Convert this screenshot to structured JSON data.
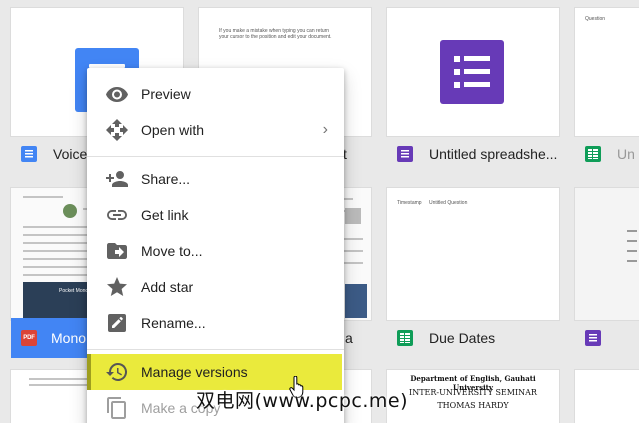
{
  "files": {
    "voice": {
      "name": "Voice",
      "type": "doc"
    },
    "quiz_doc": {
      "name": "t",
      "preview_text": "If you make a mistake when typing you can return your cursor to the position and edit your document."
    },
    "untitled_spreadsheet": {
      "name": "Untitled spreadshe...",
      "type": "form"
    },
    "untitled_right": {
      "name": "Un",
      "type": "sheet",
      "preview_text": "Question"
    },
    "mono": {
      "name": "Mono",
      "type": "pdf",
      "icon_text": "PDF",
      "preview_subtitle": "Pocket Mono"
    },
    "middle_bottom": {
      "name": "a"
    },
    "due_dates": {
      "name": "Due Dates",
      "type": "sheet",
      "preview_col1": "Timestamp",
      "preview_col2": "Untitled Question"
    },
    "right_bottom": {
      "type": "form"
    },
    "gauhati": {
      "line1": "Department of English, Gauhati University",
      "line2": "INTER-UNIVERSITY SEMINAR",
      "line3": "THOMAS HARDY"
    }
  },
  "context_menu": {
    "items": [
      {
        "label": "Preview",
        "icon": "eye-icon"
      },
      {
        "label": "Open with",
        "icon": "move-arrows-icon",
        "has_submenu": true
      },
      {
        "label": "Share...",
        "icon": "add-person-icon"
      },
      {
        "label": "Get link",
        "icon": "link-icon"
      },
      {
        "label": "Move to...",
        "icon": "folder-move-icon"
      },
      {
        "label": "Add star",
        "icon": "star-icon"
      },
      {
        "label": "Rename...",
        "icon": "pencil-icon"
      },
      {
        "label": "Manage versions",
        "icon": "history-icon",
        "highlighted": true
      },
      {
        "label": "Make a copy",
        "icon": "copy-icon"
      }
    ],
    "submenu_glyph": "›"
  },
  "watermark": "双电网(www.pcpc.me)",
  "colors": {
    "doc_blue": "#4285f4",
    "form_purple": "#673ab7",
    "sheet_green": "#0f9d58",
    "pdf_red": "#db4437",
    "highlight_yellow": "#eaea3c"
  }
}
